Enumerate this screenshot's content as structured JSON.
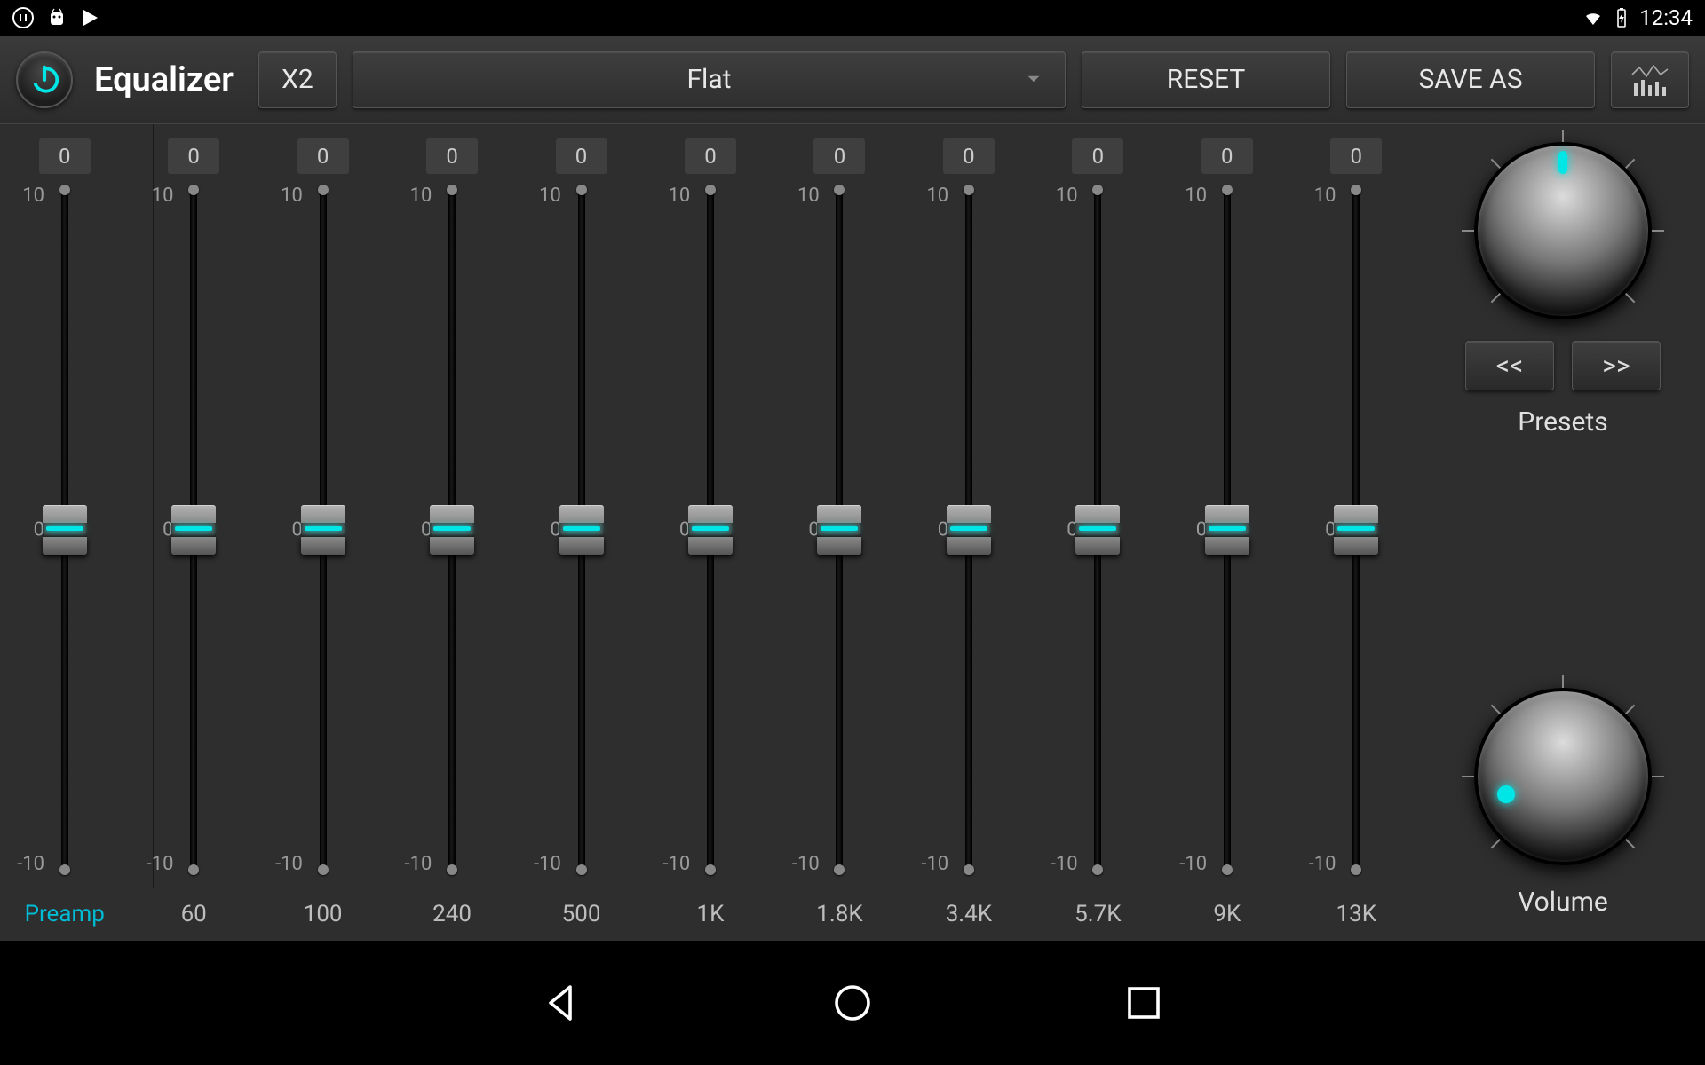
{
  "status": {
    "time": "12:34"
  },
  "toolbar": {
    "title": "Equalizer",
    "x2_label": "X2",
    "preset": "Flat",
    "reset_label": "RESET",
    "save_label": "SAVE AS"
  },
  "bands": {
    "max": "10",
    "mid": "0",
    "min": "-10",
    "items": [
      {
        "value": "0",
        "label": "Preamp"
      },
      {
        "value": "0",
        "label": "60"
      },
      {
        "value": "0",
        "label": "100"
      },
      {
        "value": "0",
        "label": "240"
      },
      {
        "value": "0",
        "label": "500"
      },
      {
        "value": "0",
        "label": "1K"
      },
      {
        "value": "0",
        "label": "1.8K"
      },
      {
        "value": "0",
        "label": "3.4K"
      },
      {
        "value": "0",
        "label": "5.7K"
      },
      {
        "value": "0",
        "label": "9K"
      },
      {
        "value": "0",
        "label": "13K"
      }
    ]
  },
  "side": {
    "prev_label": "<<",
    "next_label": ">>",
    "presets_label": "Presets",
    "volume_label": "Volume"
  }
}
